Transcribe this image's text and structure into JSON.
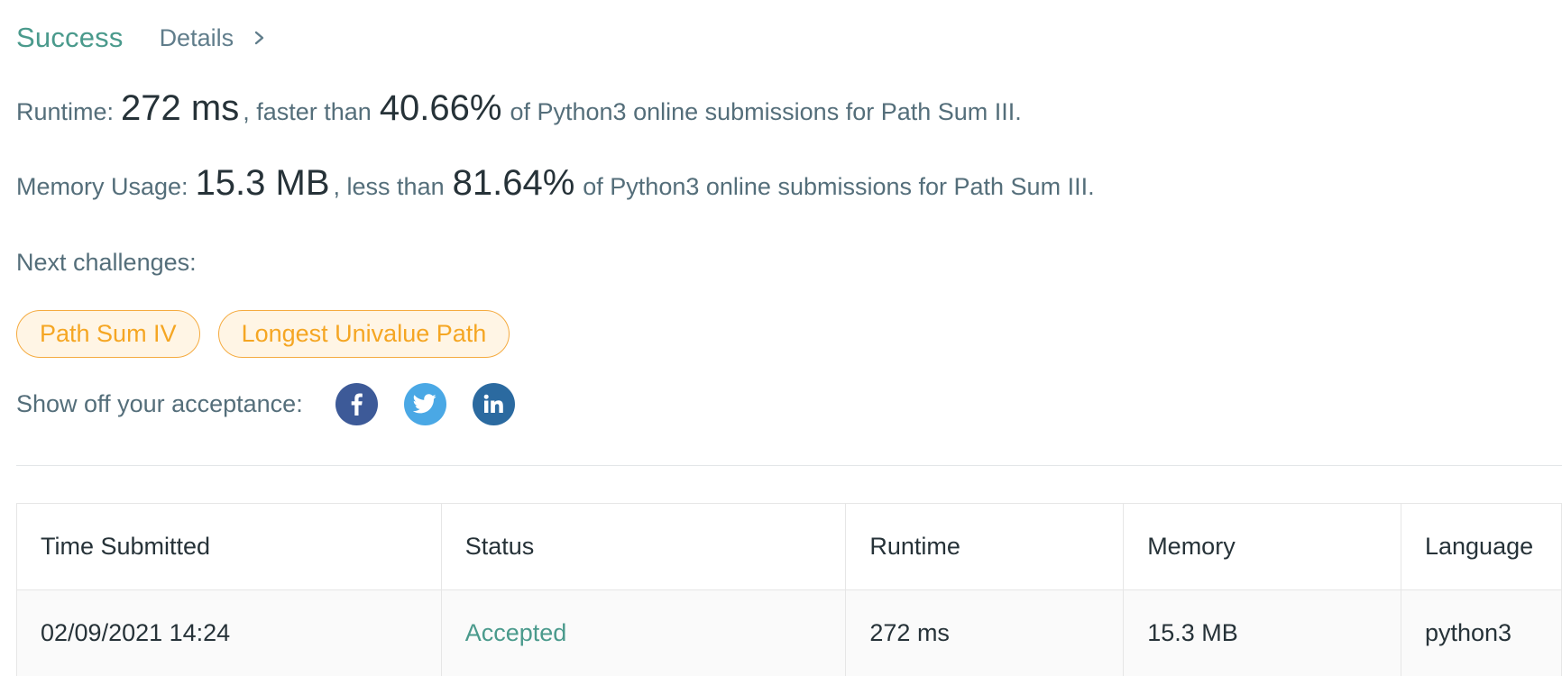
{
  "header": {
    "status": "Success",
    "details_label": "Details",
    "status_color": "#4a9a8c"
  },
  "runtime_stat": {
    "label": "Runtime:",
    "value": "272 ms",
    "connector": ", faster than",
    "percent": "40.66%",
    "suffix": "of Python3 online submissions for Path Sum III."
  },
  "memory_stat": {
    "label": "Memory Usage:",
    "value": "15.3 MB",
    "connector": ", less than",
    "percent": "81.64%",
    "suffix": "of Python3 online submissions for Path Sum III."
  },
  "next_challenges": {
    "label": "Next challenges:",
    "items": [
      {
        "label": "Path Sum IV"
      },
      {
        "label": "Longest Univalue Path"
      }
    ],
    "chip_color": "#f5a623"
  },
  "share": {
    "label": "Show off your acceptance:",
    "networks": [
      {
        "icon": "facebook-icon",
        "color": "#3d5a98"
      },
      {
        "icon": "twitter-icon",
        "color": "#4aa8e5"
      },
      {
        "icon": "linkedin-icon",
        "color": "#2b6aa0"
      }
    ]
  },
  "submissions": {
    "columns": [
      "Time Submitted",
      "Status",
      "Runtime",
      "Memory",
      "Language"
    ],
    "rows": [
      {
        "time": "02/09/2021 14:24",
        "status": "Accepted",
        "runtime": "272 ms",
        "memory": "15.3 MB",
        "language": "python3"
      }
    ]
  }
}
